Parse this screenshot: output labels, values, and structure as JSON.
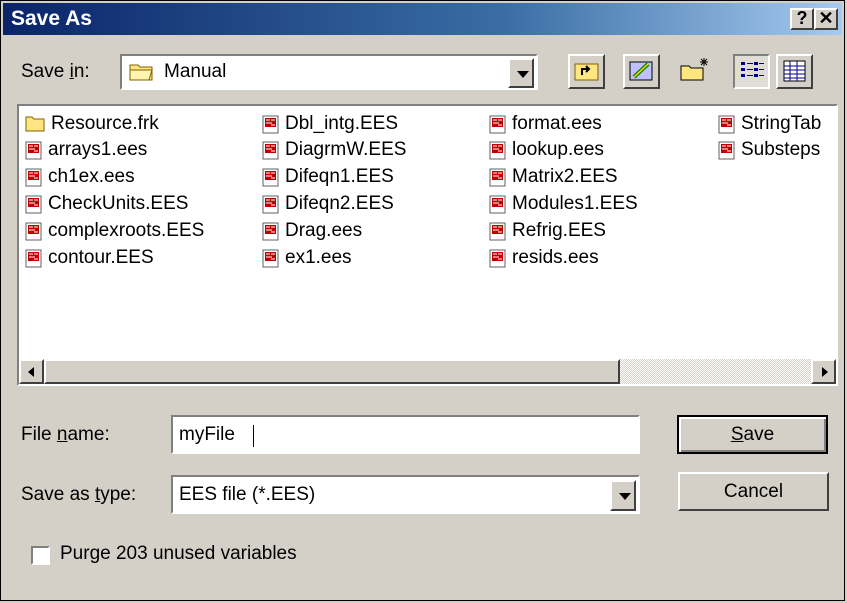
{
  "dialog": {
    "title": "Save As",
    "help_button": "?",
    "close_button": "✕"
  },
  "save_in": {
    "label_pre": "Save ",
    "label_u": "i",
    "label_post": "n:",
    "value": "Manual"
  },
  "files": [
    {
      "name": "Resource.frk",
      "icon": "folder-icon"
    },
    {
      "name": "arrays1.ees",
      "icon": "ees-file-icon"
    },
    {
      "name": "ch1ex.ees",
      "icon": "ees-file-icon"
    },
    {
      "name": "CheckUnits.EES",
      "icon": "ees-file-icon"
    },
    {
      "name": "complexroots.EES",
      "icon": "ees-file-icon"
    },
    {
      "name": "contour.EES",
      "icon": "ees-file-icon"
    },
    {
      "name": "Dbl_intg.EES",
      "icon": "ees-file-icon"
    },
    {
      "name": "DiagrmW.EES",
      "icon": "ees-file-icon"
    },
    {
      "name": "Difeqn1.EES",
      "icon": "ees-file-icon"
    },
    {
      "name": "Difeqn2.EES",
      "icon": "ees-file-icon"
    },
    {
      "name": "Drag.ees",
      "icon": "ees-file-icon"
    },
    {
      "name": "ex1.ees",
      "icon": "ees-file-icon"
    },
    {
      "name": "format.ees",
      "icon": "ees-file-icon"
    },
    {
      "name": "lookup.ees",
      "icon": "ees-file-icon"
    },
    {
      "name": "Matrix2.EES",
      "icon": "ees-file-icon"
    },
    {
      "name": "Modules1.EES",
      "icon": "ees-file-icon"
    },
    {
      "name": "Refrig.EES",
      "icon": "ees-file-icon"
    },
    {
      "name": "resids.ees",
      "icon": "ees-file-icon"
    },
    {
      "name": "StringTab",
      "icon": "ees-file-icon"
    },
    {
      "name": "Substeps",
      "icon": "ees-file-icon"
    }
  ],
  "file_name": {
    "label_pre": "File ",
    "label_u": "n",
    "label_post": "ame:",
    "value": "myFile"
  },
  "save_type": {
    "label_pre": "Save as ",
    "label_u": "t",
    "label_post": "ype:",
    "value": "EES file (*.EES)"
  },
  "buttons": {
    "save_u": "S",
    "save_rest": "ave",
    "cancel": "Cancel"
  },
  "purge": {
    "label": "Purge 203 unused variables",
    "checked": false
  }
}
